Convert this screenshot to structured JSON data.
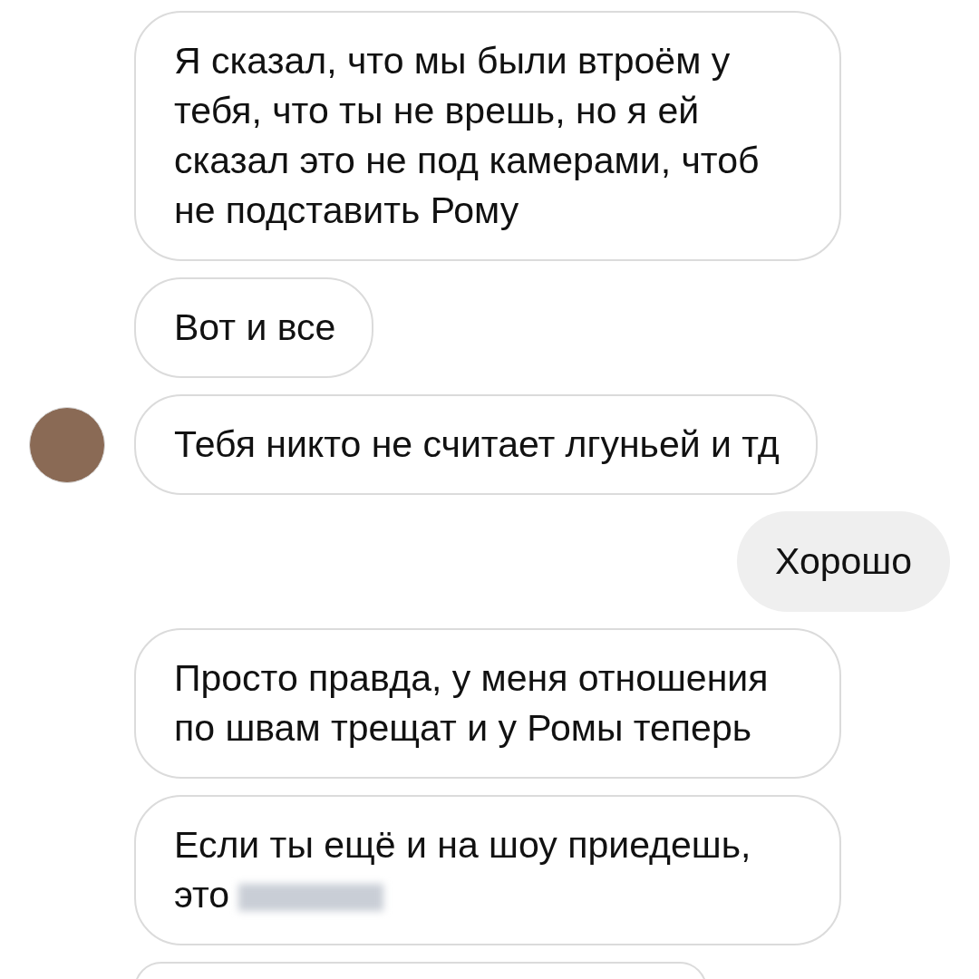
{
  "messages": [
    {
      "kind": "received",
      "text": "Я сказал, что мы были втроём у тебя, что ты не врешь, но я ей сказал это не под камерами, чтоб не подставить Рому",
      "avatar": false,
      "redacted": false
    },
    {
      "kind": "received",
      "text": "Вот и все",
      "avatar": false,
      "redacted": false
    },
    {
      "kind": "received",
      "text": "Тебя никто не считает лгуньей и тд",
      "avatar": true,
      "redacted": false
    },
    {
      "kind": "sent",
      "text": "Хорошо",
      "redacted": false
    },
    {
      "kind": "received",
      "text": "Просто правда, у меня отношения по швам трещат и у Ромы теперь",
      "avatar": false,
      "redacted": false
    },
    {
      "kind": "received",
      "text": "Если ты ещё и на шоу приедешь, это",
      "avatar": false,
      "redacted": true
    },
    {
      "kind": "cut_off",
      "avatar": false
    }
  ]
}
